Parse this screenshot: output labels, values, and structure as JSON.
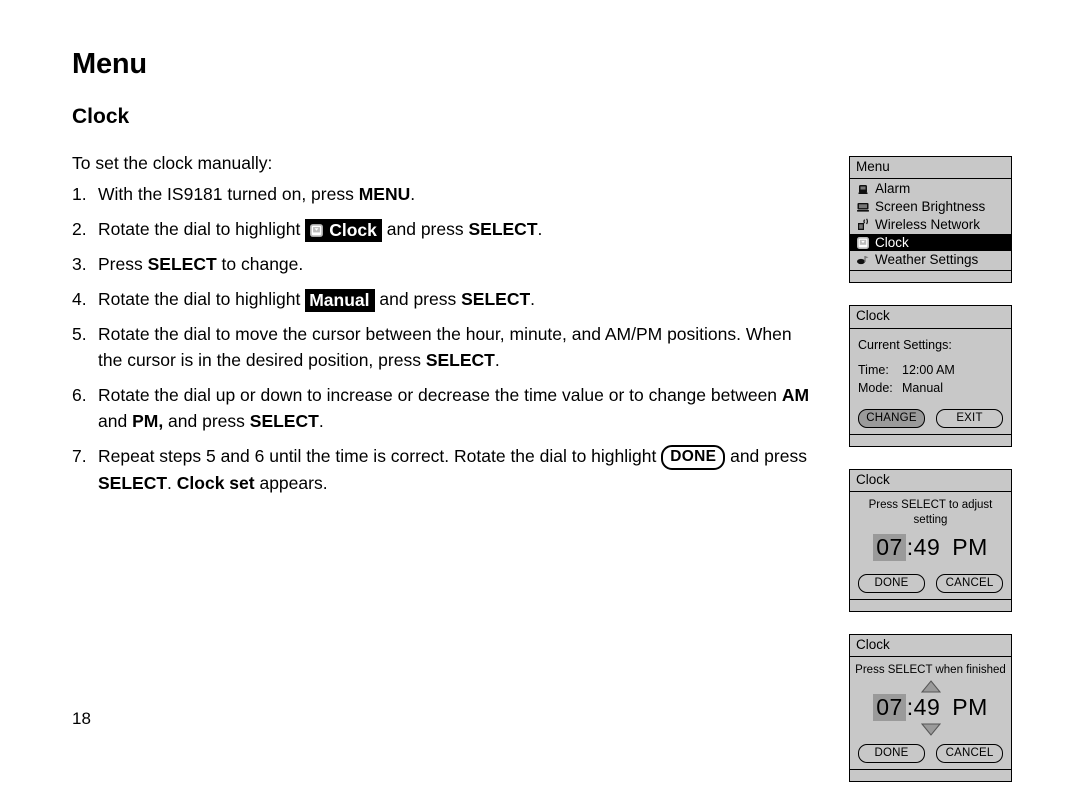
{
  "document": {
    "page_title": "Menu",
    "section_title": "Clock",
    "page_number": "18",
    "intro": "To set the clock manually:"
  },
  "steps": [
    {
      "num": "1.",
      "parts": [
        {
          "t": "text",
          "v": "With the IS9181 turned on, press "
        },
        {
          "t": "bold",
          "v": "MENU"
        },
        {
          "t": "text",
          "v": "."
        }
      ]
    },
    {
      "num": "2.",
      "parts": [
        {
          "t": "text",
          "v": "Rotate the dial to highlight "
        },
        {
          "t": "badge-icon",
          "v": "Clock",
          "icon": "clock-menu-icon"
        },
        {
          "t": "text",
          "v": " and press "
        },
        {
          "t": "bold",
          "v": "SELECT"
        },
        {
          "t": "text",
          "v": "."
        }
      ]
    },
    {
      "num": "3.",
      "parts": [
        {
          "t": "text",
          "v": "Press "
        },
        {
          "t": "bold",
          "v": "SELECT"
        },
        {
          "t": "text",
          "v": " to change."
        }
      ]
    },
    {
      "num": "4.",
      "parts": [
        {
          "t": "text",
          "v": "Rotate the dial to highlight "
        },
        {
          "t": "badge",
          "v": "Manual"
        },
        {
          "t": "text",
          "v": " and press "
        },
        {
          "t": "bold",
          "v": "SELECT"
        },
        {
          "t": "text",
          "v": "."
        }
      ]
    },
    {
      "num": "5.",
      "parts": [
        {
          "t": "text",
          "v": "Rotate the dial to move the cursor between the hour, minute, and AM/PM positions. When the cursor is in the desired position, press "
        },
        {
          "t": "bold",
          "v": "SELECT"
        },
        {
          "t": "text",
          "v": "."
        }
      ]
    },
    {
      "num": "6.",
      "parts": [
        {
          "t": "text",
          "v": "Rotate the dial up or down to increase or decrease the time value or to change between "
        },
        {
          "t": "bold",
          "v": "AM"
        },
        {
          "t": "text",
          "v": " and "
        },
        {
          "t": "bold",
          "v": "PM,"
        },
        {
          "t": "text",
          "v": " and press "
        },
        {
          "t": "bold",
          "v": "SELECT"
        },
        {
          "t": "text",
          "v": "."
        }
      ]
    },
    {
      "num": "7.",
      "parts": [
        {
          "t": "text",
          "v": "Repeat steps 5 and 6 until the time is correct. Rotate the dial to highlight "
        },
        {
          "t": "pill",
          "v": "DONE"
        },
        {
          "t": "text",
          "v": " and press "
        },
        {
          "t": "bold",
          "v": "SELECT"
        },
        {
          "t": "text",
          "v": ". "
        },
        {
          "t": "bold",
          "v": "Clock set"
        },
        {
          "t": "text",
          "v": " appears."
        }
      ]
    }
  ],
  "screens": {
    "menu_screen": {
      "title": "Menu",
      "items": [
        {
          "label": "Alarm",
          "icon": "alarm-icon",
          "selected": false
        },
        {
          "label": "Screen Brightness",
          "icon": "brightness-icon",
          "selected": false
        },
        {
          "label": "Wireless Network",
          "icon": "wireless-icon",
          "selected": false
        },
        {
          "label": "Clock",
          "icon": "clock-icon",
          "selected": true
        },
        {
          "label": "Weather Settings",
          "icon": "weather-icon",
          "selected": false
        }
      ]
    },
    "clock_settings_screen": {
      "title": "Clock",
      "current_settings_label": "Current Settings:",
      "rows": [
        {
          "key": "Time:",
          "value": "12:00 AM"
        },
        {
          "key": "Mode:",
          "value": "Manual"
        }
      ],
      "buttons": [
        {
          "label": "CHANGE",
          "state": "pressed"
        },
        {
          "label": "EXIT",
          "state": "normal"
        }
      ]
    },
    "clock_adjust_screen": {
      "title": "Clock",
      "prompt": "Press SELECT to adjust setting",
      "time": {
        "hour": "07",
        "minute": ":49",
        "ampm": "PM"
      },
      "buttons": [
        {
          "label": "DONE",
          "state": "normal"
        },
        {
          "label": "CANCEL",
          "state": "normal"
        }
      ]
    },
    "clock_finish_screen": {
      "title": "Clock",
      "prompt": "Press SELECT when finished",
      "time": {
        "hour": "07",
        "minute": ":49",
        "ampm": "PM"
      },
      "buttons": [
        {
          "label": "DONE",
          "state": "normal"
        },
        {
          "label": "CANCEL",
          "state": "normal"
        }
      ]
    }
  },
  "colors": {
    "screen_bg": "#c8c8c8",
    "selected_bg": "#000000",
    "pressed_btn": "#9a9a9a",
    "highlight_field": "#9a9a9a"
  }
}
